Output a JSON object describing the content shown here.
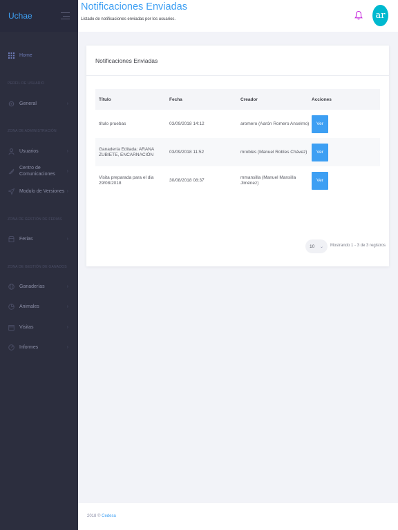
{
  "brand": {
    "name": "Uchae"
  },
  "header": {
    "title": "Notificaciones Enviadas",
    "subtitle": "Listado de notificaciones enviadas por los usuarios.",
    "avatar_initials": "ar",
    "accent": "#3d9ff3",
    "bell_color": "#c72cdd",
    "avatar_color": "#00b9cf"
  },
  "sidebar": {
    "home": "Home",
    "sections": [
      "PERFIL DE USUARIO",
      "ZONA DE ADMINISTRACIÓN",
      "ZONA DE GESTIÓN DE FERIAS",
      "ZONA DE GESTIÓN DE GANADOS"
    ],
    "items": [
      {
        "label": "General",
        "icon": "settings-icon"
      },
      {
        "label": "Usuarios",
        "icon": "user-icon"
      },
      {
        "label": "Centro de Comunicaciones",
        "icon": "antenna-icon"
      },
      {
        "label": "Modulo de Versiones",
        "icon": "send-icon"
      },
      {
        "label": "Ferias",
        "icon": "shop-icon"
      },
      {
        "label": "Ganaderías",
        "icon": "globe-icon"
      },
      {
        "label": "Animales",
        "icon": "pie-icon"
      },
      {
        "label": "Visitas",
        "icon": "calendar-icon"
      },
      {
        "label": "Informes",
        "icon": "report-icon"
      }
    ]
  },
  "card": {
    "title": "Notificaciones Enviadas",
    "columns": [
      "Título",
      "Fecha",
      "Creador",
      "Acciones"
    ],
    "rows": [
      {
        "titulo": "título pruebas",
        "fecha": "03/09/2018 14:12",
        "creador": "aromero (Aarón Romero Anselmo)",
        "accion": "Ver"
      },
      {
        "titulo": "Ganadería Editada: ARANA ZUBIETE, ENCARNACIÓN",
        "fecha": "03/09/2018 11:52",
        "creador": "mrobles (Manuel Robles Chávez)",
        "accion": "Ver"
      },
      {
        "titulo": "Visita preparada para el dia 29/08/2018",
        "fecha": "30/08/2018 08:37",
        "creador": "mmansilla (Manuel Mansilla Jiménez)",
        "accion": "Ver"
      }
    ],
    "page_size": "10",
    "showing": "Mostrando 1 - 3 de 3 registros"
  },
  "footer": {
    "year": "2018 ©",
    "link": "Cedesa"
  }
}
